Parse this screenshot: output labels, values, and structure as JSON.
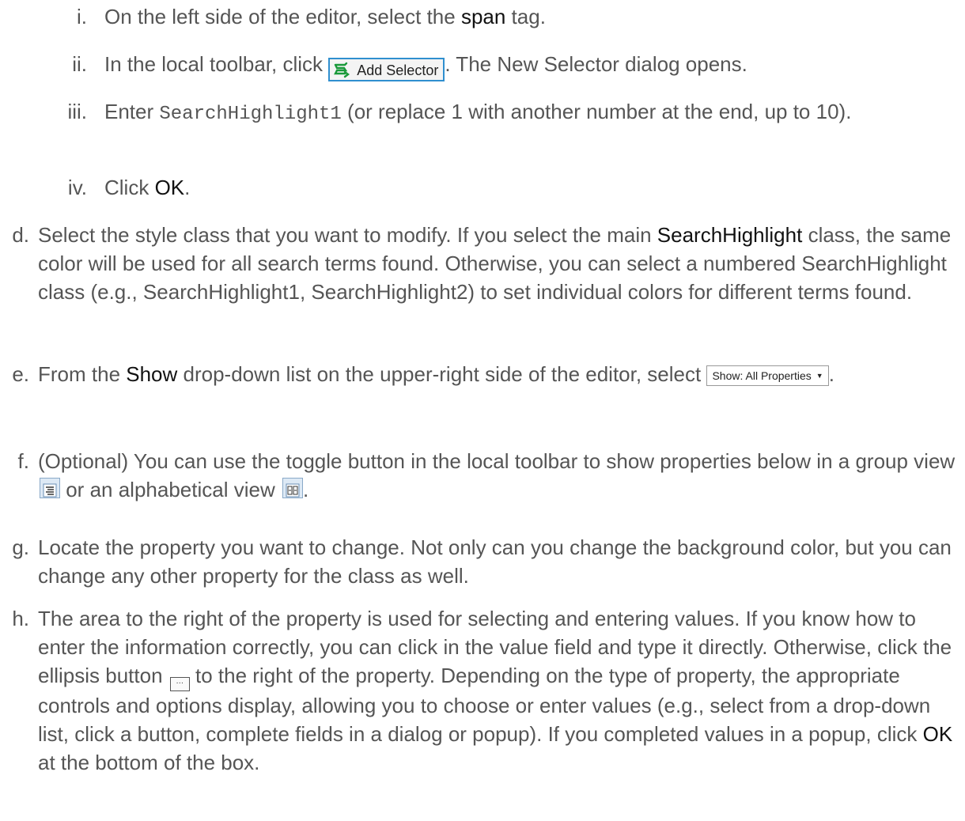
{
  "steps": {
    "i": {
      "marker": "i.",
      "t1": "On the left side of the editor, select the ",
      "b1": "span",
      "t2": " tag."
    },
    "ii": {
      "marker": "ii.",
      "t1": "In the local toolbar, click ",
      "button_label": "Add Selector",
      "button_icon": "add-selector-icon",
      "t2": ". The New Selector dialog opens."
    },
    "iii": {
      "marker": "iii.",
      "t1": "Enter ",
      "code": "SearchHighlight1",
      "t2": " (or replace 1 with another number at the end, up to 10)."
    },
    "iv": {
      "marker": "iv.",
      "t1": "Click ",
      "b1": "OK",
      "t2": "."
    },
    "d": {
      "marker": "d.",
      "t1": "Select the style class that you want to modify. If you select the main ",
      "b1": "SearchHighlight",
      "t2": " class, the same color will be used for all search terms found. Otherwise, you can select a numbered SearchHighlight class (e.g., SearchHighlight1, SearchHighlight2) to set individual colors for different terms found."
    },
    "e": {
      "marker": "e.",
      "t1": "From the ",
      "b1": "Show",
      "t2": " drop-down list on the upper-right side of the editor, select ",
      "dropdown_label": "Show: All Properties",
      "t3": "."
    },
    "f": {
      "marker": "f.",
      "t1": "(Optional) You can use the toggle button in the local toolbar to show properties below in a group view ",
      "t2": " or an alphabetical view ",
      "t3": ".",
      "group_icon": "group-view-icon",
      "alpha_icon": "alphabetical-view-icon"
    },
    "g": {
      "marker": "g.",
      "t1": "Locate the property you want to change. Not only can you change the background color, but you can change any other property for the class as well."
    },
    "h": {
      "marker": "h.",
      "t1": "The area to the right of the property is used for selecting and entering values. If you know how to enter the information correctly, you can click in the value field and type it directly. Otherwise, click the ellipsis button ",
      "ellipsis_label": "…",
      "t2": " to the right of the property. Depending on the type of property, the appropriate controls and options display, allowing you to choose or enter values (e.g., select from a drop-down list, click a button, complete fields in a dialog or popup). If you completed values in a popup, click ",
      "b1": "OK",
      "t3": " at the bottom of the box."
    }
  },
  "colors": {
    "text": "#555555",
    "emphasis": "#111111",
    "button_border": "#2f8fcf",
    "icon_green": "#1a9a3a"
  }
}
